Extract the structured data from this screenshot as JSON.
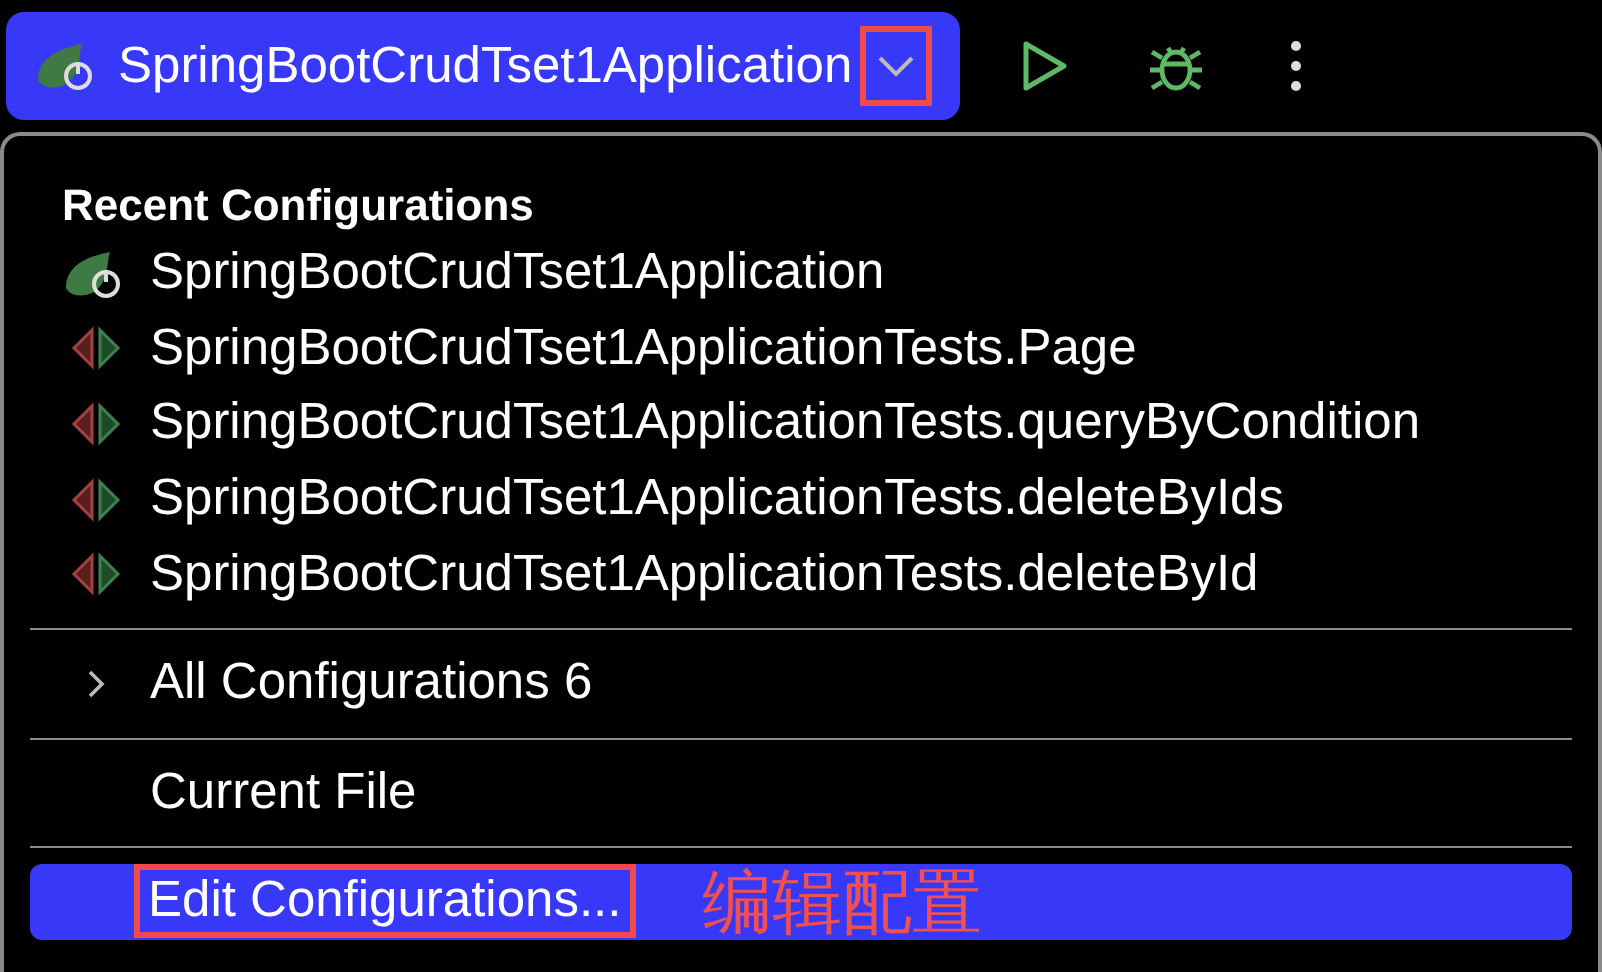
{
  "run_config": {
    "name": "SpringBootCrudTset1Application"
  },
  "popup": {
    "header": "Recent Configurations",
    "recent": [
      {
        "kind": "spring",
        "label": "SpringBootCrudTset1Application"
      },
      {
        "kind": "test",
        "label": "SpringBootCrudTset1ApplicationTests.Page"
      },
      {
        "kind": "test",
        "label": "SpringBootCrudTset1ApplicationTests.queryByCondition"
      },
      {
        "kind": "test",
        "label": "SpringBootCrudTset1ApplicationTests.deleteByIds"
      },
      {
        "kind": "test",
        "label": "SpringBootCrudTset1ApplicationTests.deleteById"
      }
    ],
    "all_configurations": {
      "label": "All Configurations 6",
      "expanded": false
    },
    "current_file": {
      "label": "Current File",
      "selected": false
    },
    "edit_configurations": {
      "label": "Edit Configurations...",
      "selected": true
    }
  },
  "annotation": "编辑配置"
}
